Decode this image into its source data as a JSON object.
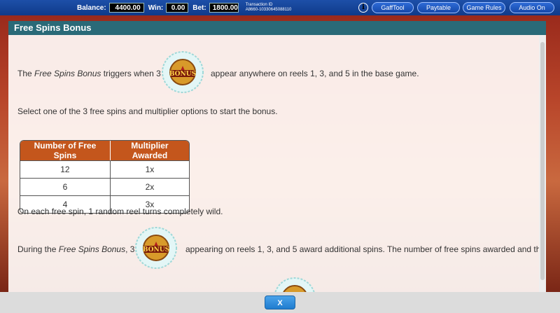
{
  "topbar": {
    "balance_label": "Balance:",
    "balance_value": "4400.00",
    "win_label": "Win:",
    "win_value": "0.00",
    "bet_label": "Bet:",
    "bet_value": "1800.00",
    "transaction_label": "Transaction ID",
    "transaction_value": "A8660-10330645088110",
    "buttons": [
      "GaffTool",
      "Paytable",
      "Game Rules",
      "Audio On"
    ]
  },
  "modal": {
    "title": "Free Spins Bonus",
    "p1_prefix": "The ",
    "p1_italic": "Free Spins Bonus",
    "p1_mid": " triggers when 3",
    "p1_suffix": "appear anywhere on reels 1, 3, and 5 in the base game.",
    "p2": "Select one of the 3 free spins and multiplier options to start the bonus.",
    "table": {
      "headers": [
        "Number of Free Spins",
        "Multiplier Awarded"
      ],
      "rows": [
        [
          "12",
          "1x"
        ],
        [
          "6",
          "2x"
        ],
        [
          "4",
          "3x"
        ]
      ]
    },
    "p3": "On each free spin, 1 random reel turns completely wild.",
    "p4_prefix": "During the ",
    "p4_italic": "Free Spins Bonus",
    "p4_mid": ", 3",
    "p4_suffix": "appearing on reels 1, 3, and 5 award additional spins. The number of free spins awarded and the",
    "bonus_symbol_text": "BONUS"
  },
  "close_label": "X",
  "colors": {
    "topbar": "#0f3a8a",
    "header": "#2a6a78",
    "table_header": "#c4561c",
    "close": "#1f7ccf"
  }
}
